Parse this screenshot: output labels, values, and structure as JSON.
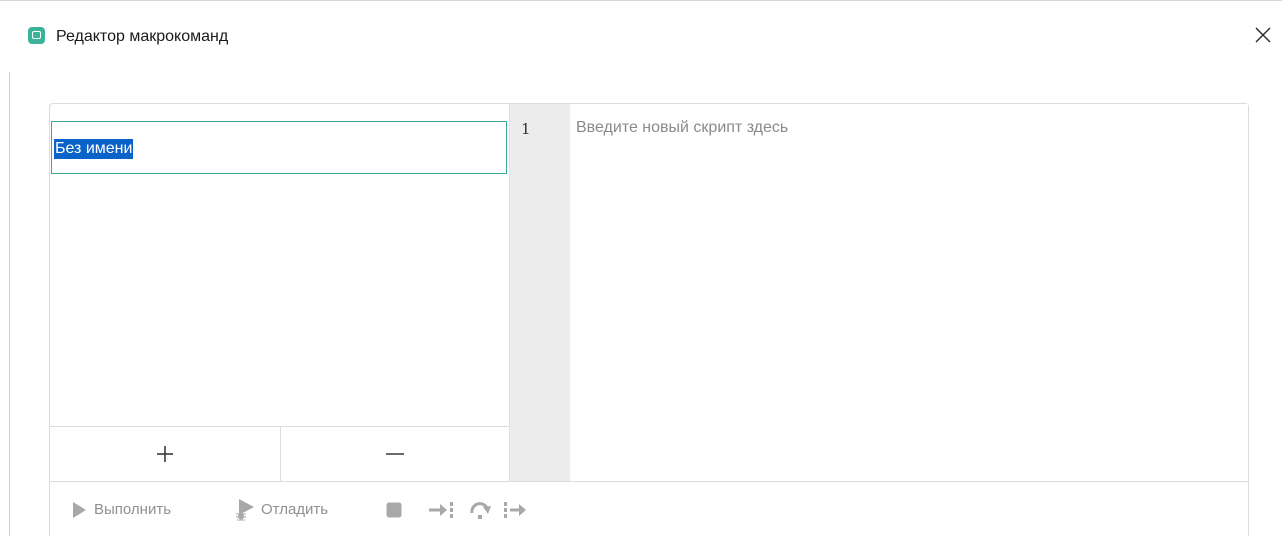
{
  "window": {
    "title": "Редактор макрокоманд",
    "close_symbol": "×"
  },
  "macro_list": {
    "items": [
      {
        "label": "Без имени",
        "selected": true
      }
    ],
    "add_symbol": "+",
    "remove_symbol": "−"
  },
  "editor": {
    "line_numbers": [
      "1"
    ],
    "placeholder": "Введите новый скрипт здесь"
  },
  "toolbar": {
    "run_label": "Выполнить",
    "debug_label": "Отладить",
    "icons": [
      "play-icon",
      "debug-icon",
      "stop-icon",
      "step-into-icon",
      "step-over-icon",
      "step-out-icon"
    ]
  },
  "colors": {
    "accent": "#3bb39a",
    "selection": "#0a63c8",
    "disabled": "#a8a8a8"
  }
}
